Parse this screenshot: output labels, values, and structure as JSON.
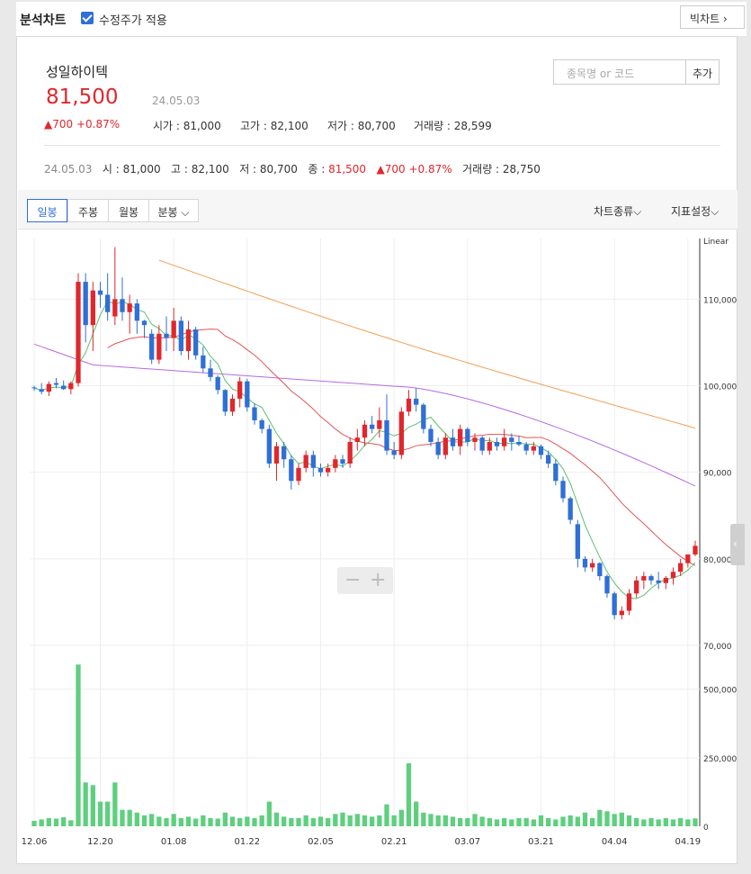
{
  "topbar": {
    "title": "분석차트",
    "checkbox_label": "수정주가 적용",
    "big_chart": "빅차트 ›"
  },
  "stock": {
    "name": "성일하이텍",
    "price": "81,500",
    "date": "24.05.03",
    "change": "▲700 +0.87%",
    "open": "시가 : 81,000",
    "high": "고가 : 82,100",
    "low": "저가 : 80,700",
    "volume": "거래량 : 28,599"
  },
  "search": {
    "placeholder": "종목명 or 코드",
    "add_label": "추가"
  },
  "daily_info": {
    "date": "24.05.03",
    "open": "시 : 81,000",
    "high": "고 : 82,100",
    "low": "저 : 80,700",
    "close_label": "종 : ",
    "close": "81,500",
    "change": "▲700 +0.87%",
    "volume": "거래량 : 28,750"
  },
  "tabs": [
    {
      "label": "일봉",
      "active": true
    },
    {
      "label": "주봉",
      "active": false
    },
    {
      "label": "월봉",
      "active": false
    },
    {
      "label": "분봉 ⌵",
      "active": false
    }
  ],
  "tools": {
    "chart_type": "차트종류⌵",
    "indicator": "지표설정⌵"
  },
  "chart_data": {
    "type": "candlestick",
    "scale": "Linear",
    "y_ticks": [
      "110,000",
      "100,000",
      "90,000",
      "80,000",
      "70,000"
    ],
    "y_tick_values": [
      110000,
      100000,
      90000,
      80000,
      70000
    ],
    "ylim": [
      70000,
      117000
    ],
    "volume_ticks": [
      "500,000",
      "250,000",
      "0"
    ],
    "volume_tick_values": [
      500000,
      250000,
      0
    ],
    "volume_max": 650000,
    "x_labels": [
      {
        "label": "12.06",
        "index": 0
      },
      {
        "label": "12.20",
        "index": 9
      },
      {
        "label": "01.08",
        "index": 19
      },
      {
        "label": "01.22",
        "index": 29
      },
      {
        "label": "02.05",
        "index": 39
      },
      {
        "label": "02.21",
        "index": 49
      },
      {
        "label": "03.07",
        "index": 59
      },
      {
        "label": "03.21",
        "index": 69
      },
      {
        "label": "04.04",
        "index": 79
      },
      {
        "label": "04.19",
        "index": 89
      }
    ],
    "candles": [
      [
        99800,
        100000,
        99400,
        99700,
        20000
      ],
      [
        99600,
        100300,
        99000,
        99300,
        25000
      ],
      [
        99300,
        100500,
        98800,
        100200,
        30000
      ],
      [
        100300,
        100900,
        99700,
        100100,
        28000
      ],
      [
        100000,
        100600,
        99500,
        99600,
        33000
      ],
      [
        99600,
        100500,
        99000,
        100300,
        22000
      ],
      [
        100300,
        113000,
        99900,
        112000,
        590000
      ],
      [
        112000,
        113000,
        105000,
        107000,
        160000
      ],
      [
        107000,
        112000,
        104000,
        111000,
        150000
      ],
      [
        111000,
        112000,
        109000,
        110500,
        90000
      ],
      [
        110500,
        113000,
        107500,
        108500,
        90000
      ],
      [
        108000,
        116000,
        107000,
        110000,
        160000
      ],
      [
        110000,
        112500,
        107500,
        108500,
        60000
      ],
      [
        108500,
        110500,
        106000,
        109500,
        60000
      ],
      [
        109500,
        110000,
        106000,
        107500,
        50000
      ],
      [
        107500,
        107600,
        105500,
        107000,
        40000
      ],
      [
        106000,
        106500,
        102500,
        103000,
        45000
      ],
      [
        103000,
        107000,
        102500,
        106000,
        35000
      ],
      [
        106000,
        108000,
        104000,
        105500,
        30000
      ],
      [
        105500,
        109000,
        104000,
        107500,
        45000
      ],
      [
        107500,
        108000,
        103500,
        104000,
        30000
      ],
      [
        104000,
        107500,
        103000,
        106500,
        35000
      ],
      [
        106500,
        106800,
        103000,
        103500,
        28000
      ],
      [
        103500,
        104500,
        101500,
        102000,
        40000
      ],
      [
        102000,
        103000,
        100500,
        101000,
        30000
      ],
      [
        101000,
        101200,
        99000,
        99500,
        28000
      ],
      [
        99500,
        99600,
        96500,
        97000,
        50000
      ],
      [
        97000,
        99000,
        96500,
        98500,
        35000
      ],
      [
        98500,
        101000,
        97500,
        100500,
        30000
      ],
      [
        100500,
        100800,
        97000,
        97500,
        35000
      ],
      [
        97500,
        98000,
        95500,
        96000,
        30000
      ],
      [
        96000,
        96200,
        94500,
        95000,
        40000
      ],
      [
        95000,
        95500,
        90500,
        91000,
        90000
      ],
      [
        91000,
        93500,
        89000,
        93000,
        50000
      ],
      [
        93000,
        93500,
        90500,
        91500,
        35000
      ],
      [
        91500,
        92000,
        88000,
        89000,
        30000
      ],
      [
        89000,
        91000,
        88500,
        90500,
        30000
      ],
      [
        90500,
        92500,
        90000,
        92000,
        40000
      ],
      [
        92000,
        92500,
        89500,
        90500,
        30000
      ],
      [
        90500,
        91000,
        89500,
        90000,
        35000
      ],
      [
        90000,
        91000,
        89500,
        90500,
        30000
      ],
      [
        90500,
        92000,
        90000,
        91500,
        45000
      ],
      [
        91500,
        92000,
        90500,
        91000,
        50000
      ],
      [
        91000,
        94000,
        90500,
        93500,
        40000
      ],
      [
        93500,
        95000,
        92500,
        94000,
        45000
      ],
      [
        94000,
        96000,
        93000,
        95500,
        40000
      ],
      [
        95500,
        96500,
        94500,
        95000,
        35000
      ],
      [
        95000,
        97500,
        94000,
        96000,
        40000
      ],
      [
        96000,
        99000,
        92000,
        92500,
        80000
      ],
      [
        92500,
        93500,
        91500,
        92000,
        40000
      ],
      [
        92000,
        97500,
        91500,
        97000,
        60000
      ],
      [
        97000,
        99500,
        96500,
        98500,
        230000
      ],
      [
        98500,
        99700,
        97000,
        97800,
        90000
      ],
      [
        97800,
        98000,
        94500,
        95000,
        50000
      ],
      [
        95000,
        95500,
        93000,
        93500,
        45000
      ],
      [
        93500,
        94000,
        91500,
        92000,
        40000
      ],
      [
        92000,
        94500,
        91500,
        94000,
        40000
      ],
      [
        94000,
        95000,
        92500,
        93000,
        35000
      ],
      [
        93000,
        95500,
        92000,
        95000,
        30000
      ],
      [
        95000,
        95200,
        93000,
        93500,
        30000
      ],
      [
        93500,
        94500,
        92500,
        94000,
        45000
      ],
      [
        94000,
        94200,
        92000,
        92500,
        35000
      ],
      [
        92500,
        94000,
        92000,
        93500,
        30000
      ],
      [
        93500,
        94000,
        92500,
        93000,
        25000
      ],
      [
        93000,
        95000,
        92500,
        94000,
        30000
      ],
      [
        94000,
        94500,
        92500,
        93500,
        25000
      ],
      [
        93500,
        94200,
        93000,
        93200,
        30000
      ],
      [
        93200,
        93500,
        92000,
        92500,
        30000
      ],
      [
        92500,
        93500,
        92000,
        93000,
        25000
      ],
      [
        93000,
        93200,
        91500,
        92000,
        40000
      ],
      [
        92000,
        92500,
        90500,
        91000,
        30000
      ],
      [
        91000,
        91500,
        88500,
        89000,
        25000
      ],
      [
        89000,
        89500,
        86500,
        87000,
        35000
      ],
      [
        87000,
        87200,
        84000,
        84500,
        40000
      ],
      [
        84000,
        84500,
        79000,
        80000,
        35000
      ],
      [
        80000,
        80300,
        78500,
        79000,
        50000
      ],
      [
        79000,
        80000,
        78500,
        79500,
        30000
      ],
      [
        79500,
        79600,
        77500,
        78000,
        60000
      ],
      [
        78000,
        78200,
        75500,
        76000,
        55000
      ],
      [
        76000,
        76200,
        73000,
        73500,
        45000
      ],
      [
        73500,
        74500,
        73000,
        74000,
        50000
      ],
      [
        74000,
        76500,
        73500,
        76000,
        40000
      ],
      [
        76000,
        78000,
        75500,
        77500,
        30000
      ],
      [
        77500,
        78500,
        76500,
        78000,
        25000
      ],
      [
        78000,
        78200,
        77000,
        77500,
        30000
      ],
      [
        77500,
        78500,
        76500,
        77200,
        25000
      ],
      [
        77200,
        78000,
        76500,
        77800,
        30000
      ],
      [
        77800,
        79000,
        77000,
        78500,
        25000
      ],
      [
        78500,
        80000,
        78000,
        79500,
        30000
      ],
      [
        79500,
        80500,
        79000,
        80500,
        25000
      ],
      [
        80500,
        82100,
        80300,
        81500,
        28750
      ]
    ],
    "ma5_color": "#5fbf6f",
    "ma20_color": "#e05555",
    "ma60_color": "#b56be0",
    "ma120_color": "#f0a050",
    "up_color": "#e0272d",
    "down_color": "#2f6fd6",
    "volume_color": "#5fcf7f"
  },
  "zoom": {
    "minus": "−",
    "plus": "+"
  }
}
